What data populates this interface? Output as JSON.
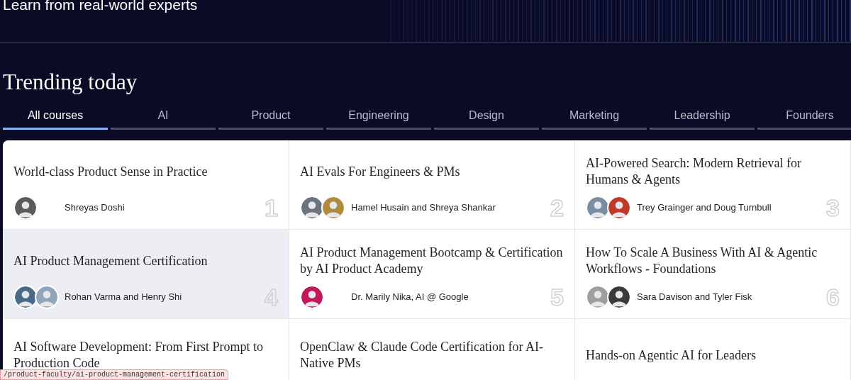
{
  "header": {
    "subtitle": "Learn from real-world experts"
  },
  "section": {
    "title": "Trending today"
  },
  "tabs": [
    {
      "label": "All courses",
      "selected": true
    },
    {
      "label": "AI",
      "selected": false
    },
    {
      "label": "Product",
      "selected": false
    },
    {
      "label": "Engineering",
      "selected": false
    },
    {
      "label": "Design",
      "selected": false
    },
    {
      "label": "Marketing",
      "selected": false
    },
    {
      "label": "Leadership",
      "selected": false
    },
    {
      "label": "Founders",
      "selected": false
    }
  ],
  "courses": [
    {
      "title": "World-class Product Sense in Practice",
      "authors": "Shreyas Doshi",
      "rank": "1",
      "hovered": false,
      "avatars": [
        {
          "color": "#5b5b5b"
        }
      ]
    },
    {
      "title": "AI Evals For Engineers & PMs",
      "authors": "Hamel Husain and Shreya Shankar",
      "rank": "2",
      "hovered": false,
      "avatars": [
        {
          "color": "#6b7280"
        },
        {
          "color": "#b08a3e"
        }
      ]
    },
    {
      "title": "AI-Powered Search: Modern Retrieval for Humans & Agents",
      "authors": "Trey Grainger and Doug Turnbull",
      "rank": "3",
      "hovered": false,
      "avatars": [
        {
          "color": "#7b8da3"
        },
        {
          "color": "#c0392b"
        }
      ]
    },
    {
      "title": "AI Product Management Certification",
      "authors": "Rohan Varma and Henry Shi",
      "rank": "4",
      "hovered": true,
      "avatars": [
        {
          "color": "#4a6a8a"
        },
        {
          "color": "#8fa5b8"
        }
      ]
    },
    {
      "title": "AI Product Management Bootcamp & Certification by AI Product Academy",
      "authors": "Dr. Marily Nika, AI @ Google",
      "rank": "5",
      "hovered": false,
      "avatars": [
        {
          "color": "#c2185b"
        }
      ]
    },
    {
      "title": "How To Scale A Business With AI & Agentic Workflows - Foundations",
      "authors": "Sara Davison and Tyler Fisk",
      "rank": "6",
      "hovered": false,
      "avatars": [
        {
          "color": "#9e9e9e"
        },
        {
          "color": "#3a3a3a"
        }
      ]
    },
    {
      "title": "AI Software Development: From First Prompt to Production Code",
      "hovered": false
    },
    {
      "title": "OpenClaw & Claude Code Certification for AI-Native PMs",
      "hovered": false
    },
    {
      "title": "Hands-on Agentic AI for Leaders",
      "hovered": false
    }
  ],
  "status_bar": {
    "url": "/product-faculty/ai-product-management-certification"
  }
}
